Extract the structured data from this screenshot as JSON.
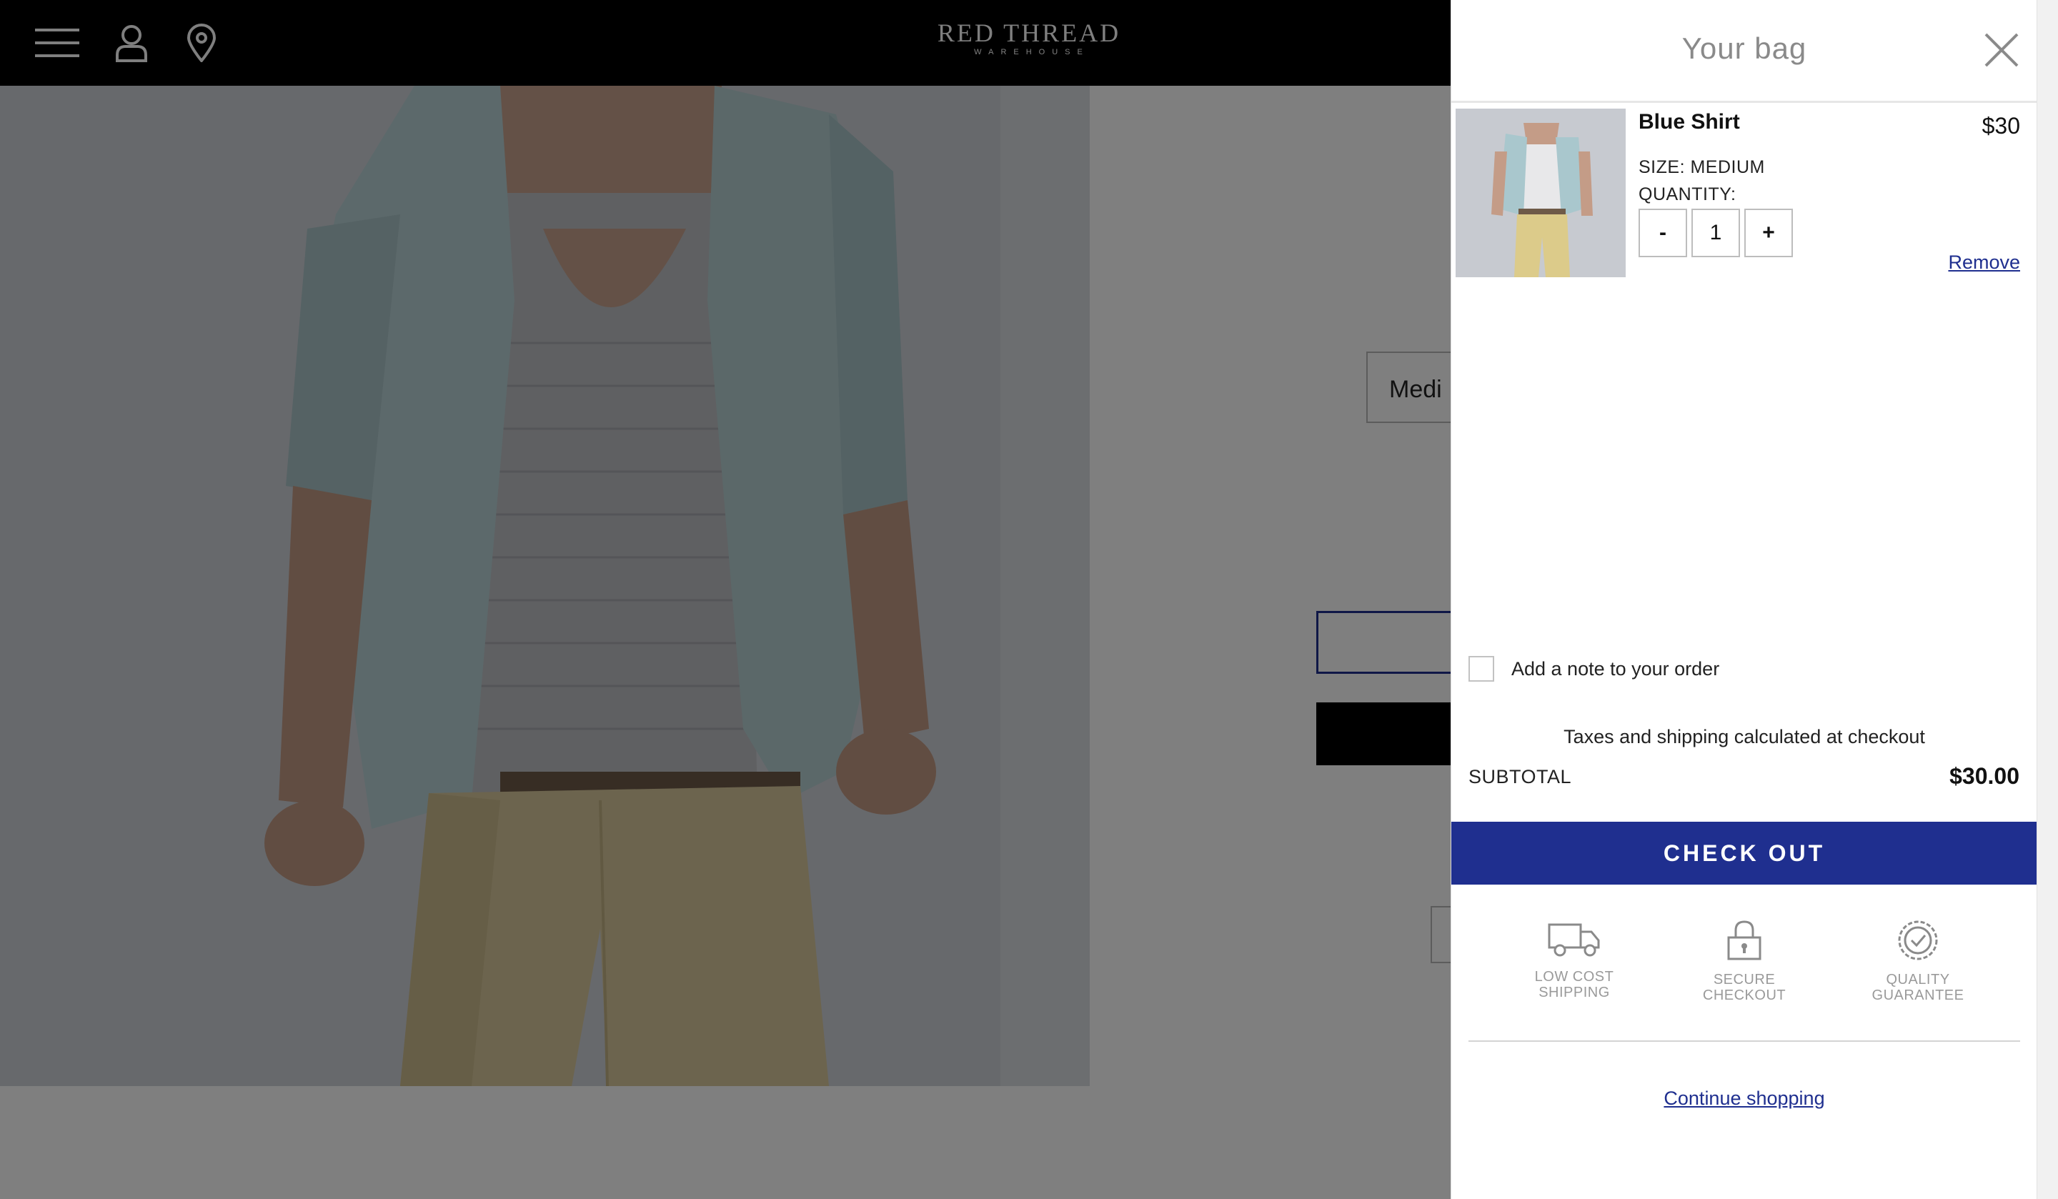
{
  "header": {
    "brand_main": "RED THREAD",
    "brand_sub": "WAREHOUSE",
    "icons": [
      "menu-icon",
      "account-icon",
      "location-icon"
    ]
  },
  "product_page": {
    "size_value": "Medi"
  },
  "cart": {
    "title": "Your bag",
    "close_icon": "close-icon",
    "item": {
      "name": "Blue Shirt",
      "price": "$30",
      "size": "SIZE: MEDIUM",
      "quantity_label": "QUANTITY:",
      "decrement": "-",
      "quantity": "1",
      "increment": "+",
      "remove": "Remove"
    },
    "note_label": "Add a note to your order",
    "tax_note": "Taxes and shipping calculated at checkout",
    "subtotal_label": "SUBTOTAL",
    "subtotal_value": "$30.00",
    "checkout_label": "CHECK OUT",
    "badges": [
      {
        "icon": "truck-icon",
        "line1": "LOW COST",
        "line2": "SHIPPING"
      },
      {
        "icon": "lock-icon",
        "line1": "SECURE",
        "line2": "CHECKOUT"
      },
      {
        "icon": "quality-badge-icon",
        "line1": "QUALITY",
        "line2": "GUARANTEE"
      }
    ],
    "continue_label": "Continue shopping"
  },
  "colors": {
    "accent": "#1f2f8f",
    "topbar": "#000000",
    "overlay": "rgba(0,0,0,0.5)"
  }
}
